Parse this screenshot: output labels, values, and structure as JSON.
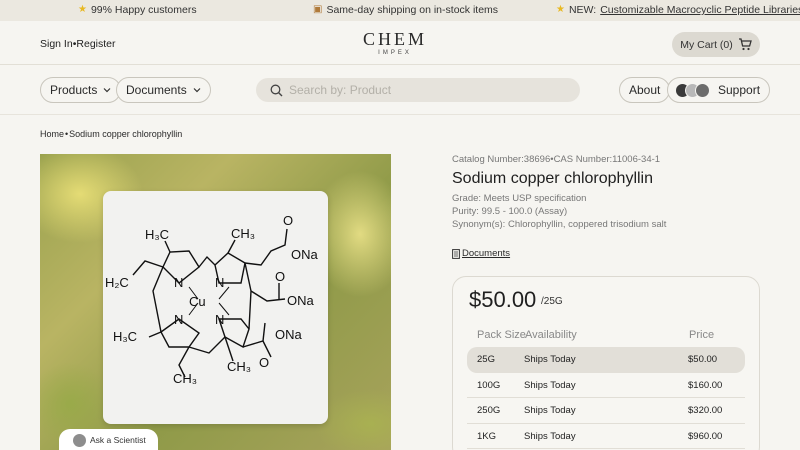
{
  "announcement": {
    "item1": "99% Happy customers",
    "item2": "Same-day shipping on in-stock items",
    "item3_prefix": "NEW:",
    "item3_link": "Customizable Macrocyclic Peptide Libraries"
  },
  "header": {
    "sign_in": "Sign In",
    "separator": "•",
    "register": "Register",
    "logo_main": "CHEM",
    "logo_sub": "IMPEX",
    "cart_label": "My Cart (0)"
  },
  "nav": {
    "products": "Products",
    "documents": "Documents",
    "search_placeholder": "Search by: Product",
    "about": "About",
    "support": "Support"
  },
  "breadcrumb": {
    "home": "Home",
    "separator": "•",
    "current": "Sodium copper chlorophyllin"
  },
  "ask_scientist": "Ask a Scientist",
  "structure": {
    "ch3_top_left": "H₃C",
    "ch3_top": "CH₃",
    "ona_1": "ONa",
    "o_1": "O",
    "h2c": "H₂C",
    "n_tl": "N",
    "n_tr": "N",
    "n_bl": "N",
    "n_br": "N",
    "cu": "Cu",
    "o_2": "O",
    "ona_2": "ONa",
    "ch3_left": "H₃C",
    "ona_3": "ONa",
    "o_3": "O",
    "ch3_bottom": "CH₃",
    "ch3_bottom2": "CH₃"
  },
  "product": {
    "catalog": "Catalog Number:38696",
    "cas": "CAS Number:11006-34-1",
    "name": "Sodium copper chlorophyllin",
    "grade": "Grade: Meets USP specification",
    "purity": "Purity: 99.5 - 100.0 (Assay)",
    "synonyms": "Synonym(s): Chlorophyllin, coppered trisodium salt",
    "documents_link": "Documents"
  },
  "pricing": {
    "price": "$50.00",
    "unit": "/25G",
    "headers": [
      "Pack Size",
      "Availability",
      "Price"
    ],
    "rows": [
      {
        "size": "25G",
        "availability": "Ships Today",
        "price": "$50.00"
      },
      {
        "size": "100G",
        "availability": "Ships Today",
        "price": "$160.00"
      },
      {
        "size": "250G",
        "availability": "Ships Today",
        "price": "$320.00"
      },
      {
        "size": "1KG",
        "availability": "Ships Today",
        "price": "$960.00"
      }
    ],
    "selected_row": 0
  }
}
